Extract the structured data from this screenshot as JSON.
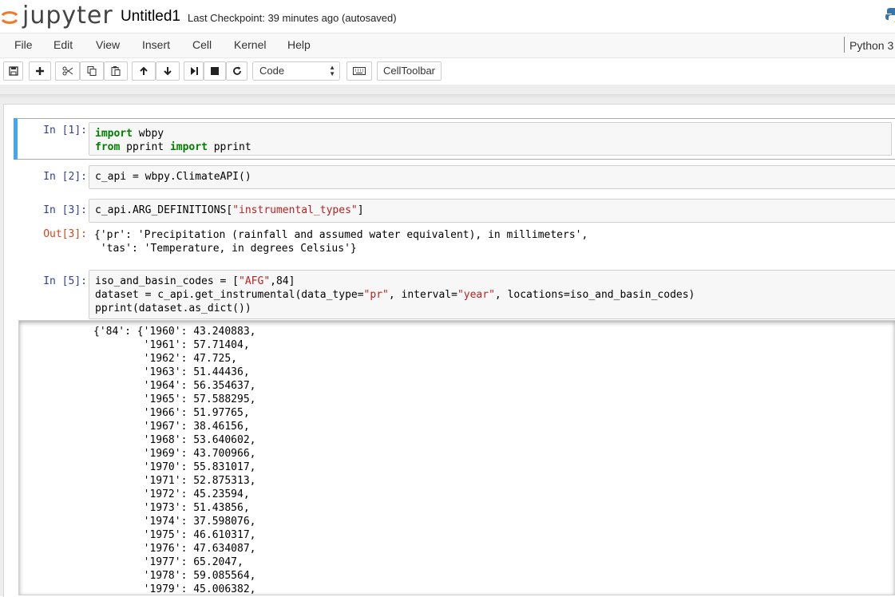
{
  "header": {
    "logo_text": "jupyter",
    "notebook_name": "Untitled1",
    "checkpoint": "Last Checkpoint: 39 minutes ago (autosaved)"
  },
  "menu": {
    "items": [
      "File",
      "Edit",
      "View",
      "Insert",
      "Cell",
      "Kernel",
      "Help"
    ],
    "kernel": "Python 3"
  },
  "toolbar": {
    "cell_type": "Code",
    "celltoolbar_label": "CellToolbar"
  },
  "cells": [
    {
      "prompt": "In [1]:",
      "lines": [
        "import wbpy",
        "from pprint import pprint"
      ]
    },
    {
      "prompt": "In [2]:",
      "lines": [
        "c_api = wbpy.ClimateAPI()"
      ]
    },
    {
      "prompt": "In [3]:",
      "lines": [
        "c_api.ARG_DEFINITIONS[\"instrumental_types\"]"
      ],
      "out_prompt": "Out[3]:",
      "output": [
        "{'pr': 'Precipitation (rainfall and assumed water equivalent), in millimeters',",
        " 'tas': 'Temperature, in degrees Celsius'}"
      ]
    },
    {
      "prompt": "In [5]:",
      "lines": [
        "iso_and_basin_codes = [\"AFG\",84]",
        "dataset = c_api.get_instrumental(data_type=\"pr\", interval=\"year\", locations=iso_and_basin_codes)",
        "pprint(dataset.as_dict())"
      ]
    }
  ],
  "scroll_output": [
    "{'84': {'1960': 43.240883,",
    "        '1961': 57.71404,",
    "        '1962': 47.725,",
    "        '1963': 51.44436,",
    "        '1964': 56.354637,",
    "        '1965': 57.588295,",
    "        '1966': 51.97765,",
    "        '1967': 38.46156,",
    "        '1968': 53.640602,",
    "        '1969': 43.700966,",
    "        '1970': 55.831017,",
    "        '1971': 52.875313,",
    "        '1972': 45.23594,",
    "        '1973': 51.43856,",
    "        '1974': 37.598076,",
    "        '1975': 46.610317,",
    "        '1976': 47.634087,",
    "        '1977': 65.2047,",
    "        '1978': 59.085564,",
    "        '1979': 45.006382,"
  ]
}
